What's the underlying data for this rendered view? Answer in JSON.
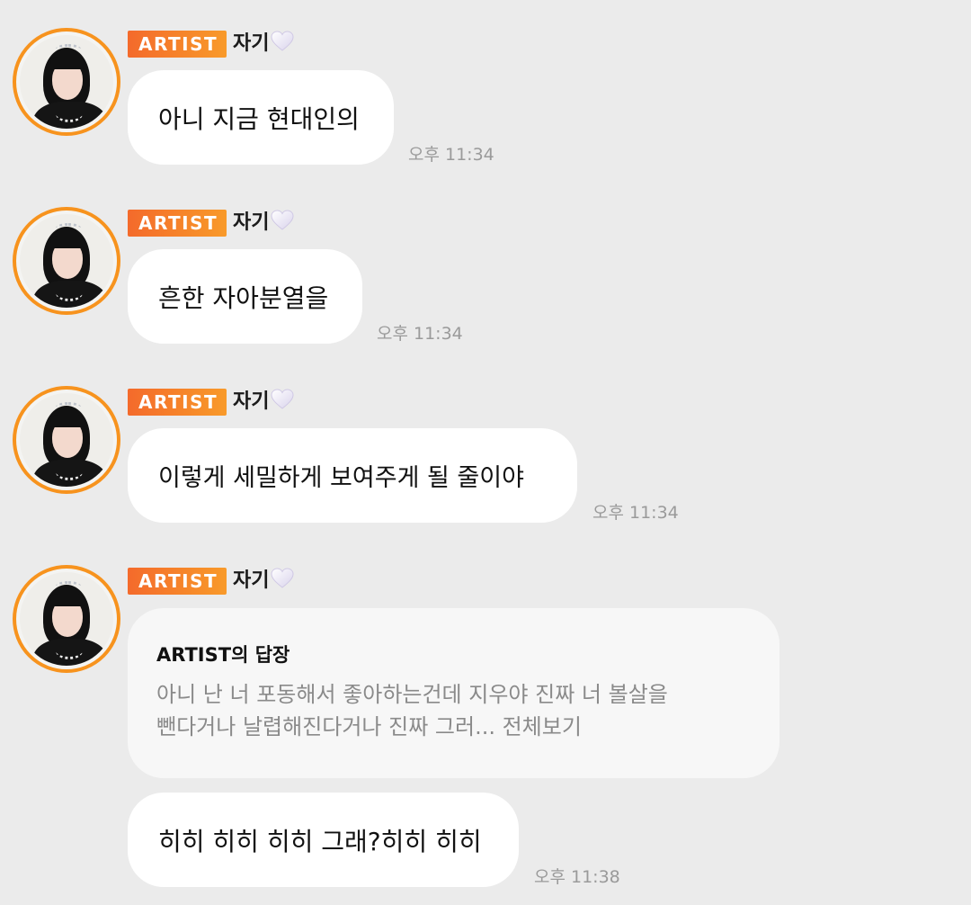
{
  "artist_badge": "ARTIST",
  "nickname": "자기",
  "messages": [
    {
      "text": "아니 지금 현대인의",
      "time": "오후 11:34"
    },
    {
      "text": "흔한 자아분열을",
      "time": "오후 11:34"
    },
    {
      "text": "이렇게 세밀하게 보여주게 될 줄이야",
      "time": "오후 11:34"
    }
  ],
  "reply": {
    "title": "ARTIST의 답장",
    "line1": "아니 난 너 포동해서 좋아하는건데 지우야 진짜 너 볼살을",
    "line2": "뺀다거나 날렵해진다거나 진짜 그러... 전체보기",
    "text": "히히 히히 히히 그래?히히 히히",
    "time": "오후 11:38"
  },
  "colors": {
    "badge_start": "#f46a2b",
    "badge_end": "#f89a2a",
    "avatar_ring": "#f7931e",
    "background": "#ebebeb"
  },
  "icons": {
    "heart": "white-heart-icon"
  }
}
